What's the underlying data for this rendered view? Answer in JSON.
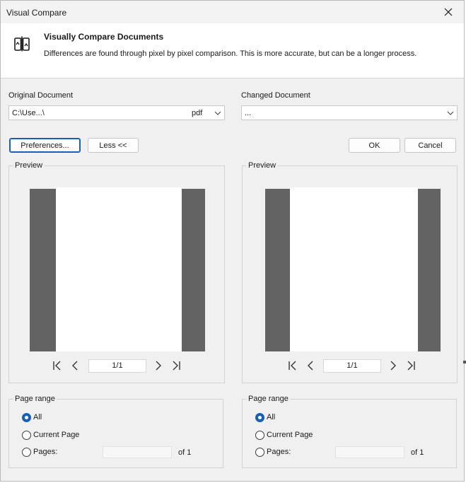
{
  "window": {
    "title": "Visual Compare",
    "close_icon": "close-icon"
  },
  "header": {
    "icon": "compare-documents-icon",
    "title": "Visually Compare Documents",
    "description": "Differences are found through pixel by pixel comparison. This is more accurate, but can be a longer process."
  },
  "original": {
    "label": "Original Document",
    "path": "C:\\Use...\\",
    "extension": "pdf",
    "preview_label": "Preview",
    "page_indicator": "1/1",
    "page_range": {
      "title": "Page range",
      "options": [
        "All",
        "Current Page",
        "Pages:"
      ],
      "selected": "All",
      "pages_value": "",
      "of_text": "of 1"
    }
  },
  "changed": {
    "label": "Changed Document",
    "path": "...",
    "preview_label": "Preview",
    "page_indicator": "1/1",
    "page_range": {
      "title": "Page range",
      "options": [
        "All",
        "Current Page",
        "Pages:"
      ],
      "selected": "All",
      "pages_value": "",
      "of_text": "of 1"
    }
  },
  "buttons": {
    "preferences": "Preferences...",
    "less": "Less <<",
    "ok": "OK",
    "cancel": "Cancel"
  },
  "colors": {
    "accent": "#1a5fb4",
    "preview_background": "#636363",
    "dialog_background": "#f0f0f0"
  }
}
